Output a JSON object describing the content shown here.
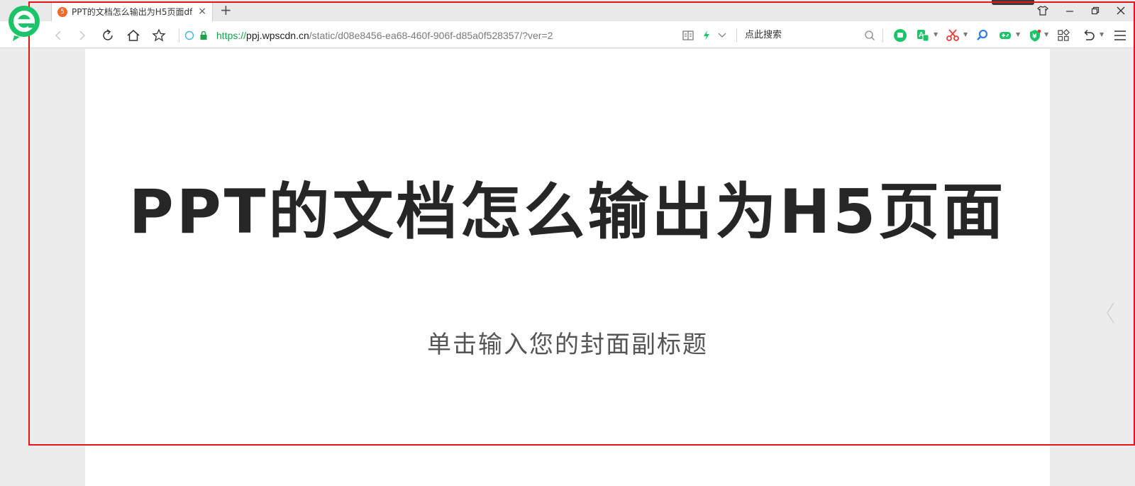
{
  "browser": {
    "tab": {
      "favicon_text": "5",
      "title": "PPT的文档怎么输出为H5页面df",
      "close_glyph": "×"
    },
    "new_tab_glyph": "+",
    "window_controls": {
      "skin_icon": "shirt-icon",
      "minimize_glyph": "—",
      "restore_glyph": "❐",
      "close_glyph": "✕"
    },
    "address": {
      "scheme": "https://",
      "host": "ppj.wpscdn.cn",
      "path": "/static/d08e8456-ea68-460f-906f-d85a0f528357/?ver=2"
    },
    "search": {
      "placeholder": "点此搜索"
    },
    "toolbar_icons": [
      "wechat-icon",
      "translate-icon",
      "screenshot-scissors-icon",
      "magnifier-icon",
      "gamepad-icon",
      "shield-icon",
      "apps-grid-icon",
      "undo-icon",
      "menu-icon"
    ],
    "colors": {
      "brand_green": "#1bc468",
      "secure_green": "#1aa34a",
      "highlight_red": "#e8141c",
      "tab_favicon": "#f06b2b"
    }
  },
  "slide": {
    "title": "PPT的文档怎么输出为H5页面",
    "subtitle": "单击输入您的封面副标题"
  }
}
